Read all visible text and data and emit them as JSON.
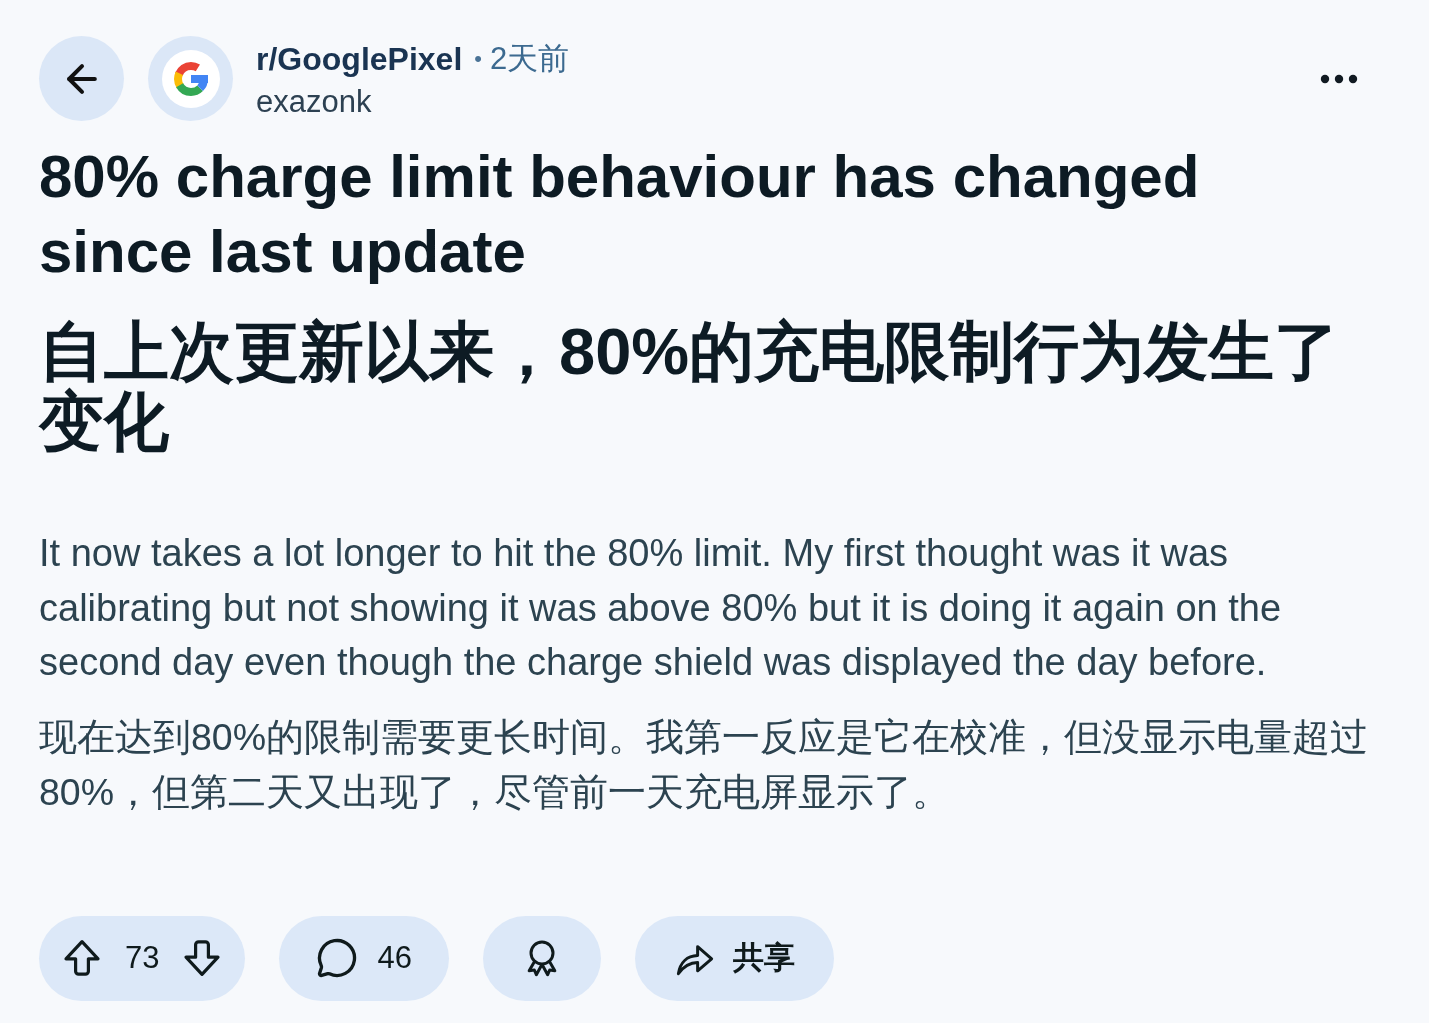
{
  "post_header": {
    "subreddit": "r/GooglePixel",
    "separator": "•",
    "time": "2天前",
    "author": "exazonk"
  },
  "title": "80% charge limit behaviour has changed since last update",
  "title_translation": "自上次更新以来，80%的充电限制行为发生了变化",
  "body": "It now takes a lot longer to hit the 80% limit. My first thought was it was calibrating but not showing it was above 80% but it is doing it again on the second day even though the charge shield was displayed the day before.",
  "body_translation": "现在达到80%的限制需要更长时间。我第一反应是它在校准，但没显示电量超过80%，但第二天又出现了，尽管前一天充电屏显示了。",
  "actions": [
    {
      "kind": "vote",
      "score": "73"
    },
    {
      "kind": "comments",
      "count": "46"
    },
    {
      "kind": "award"
    },
    {
      "kind": "share",
      "label": "共享"
    }
  ]
}
